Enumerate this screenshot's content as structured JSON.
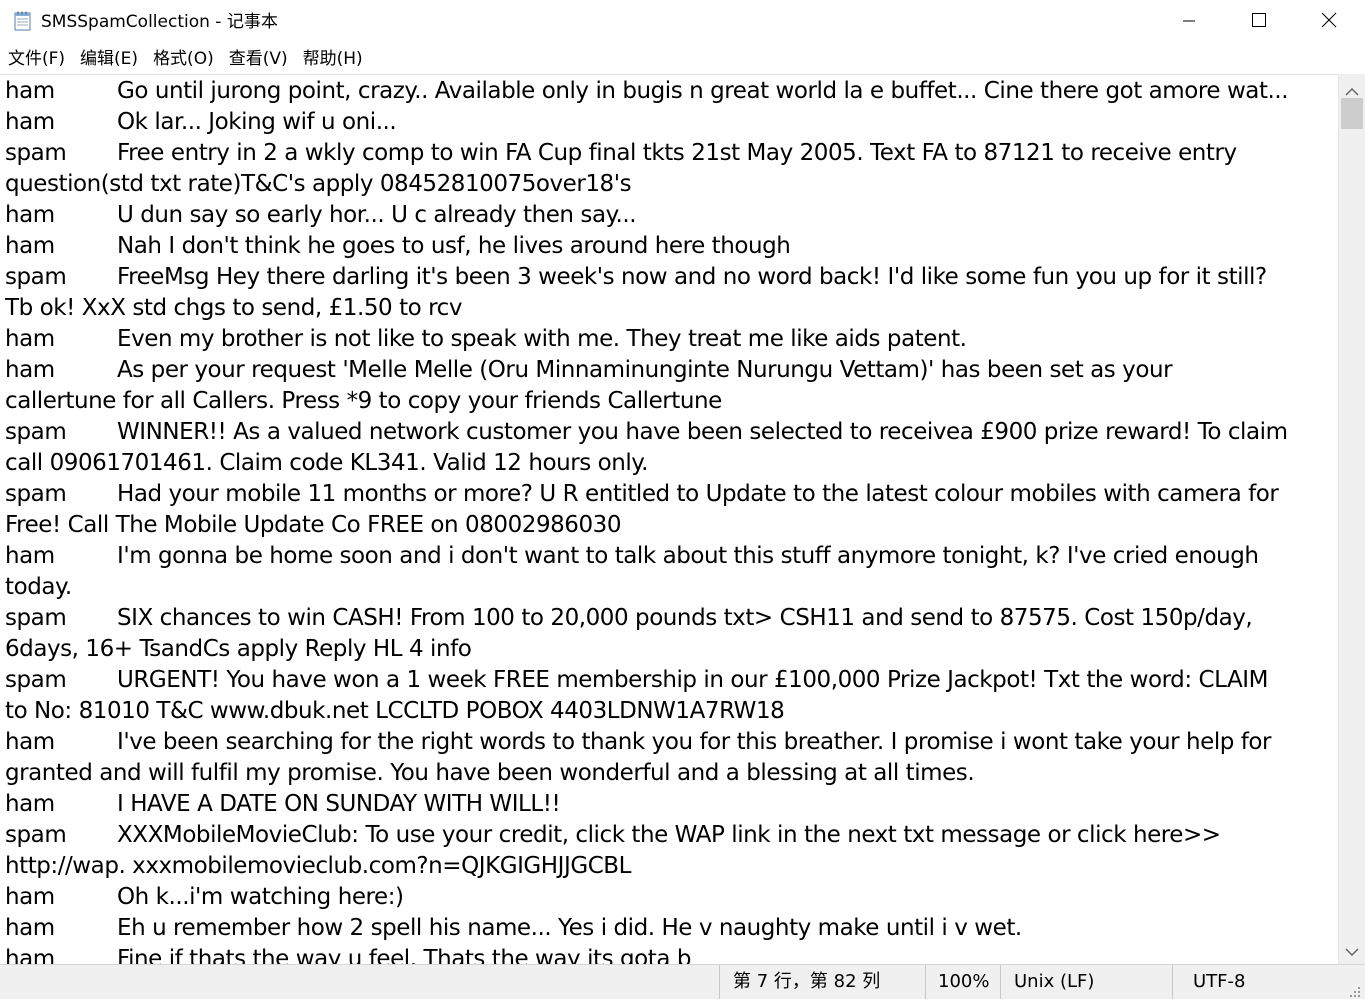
{
  "window": {
    "title": "SMSSpamCollection - 记事本",
    "icon": "notepad-icon",
    "controls": {
      "minimize": "minimize-icon",
      "maximize": "maximize-icon",
      "close": "close-icon"
    }
  },
  "menu": {
    "items": [
      "文件(F)",
      "编辑(E)",
      "格式(O)",
      "查看(V)",
      "帮助(H)"
    ]
  },
  "editor": {
    "lines": [
      {
        "label": "ham",
        "text": "Go until jurong point, crazy.. Available only in bugis n great world la e buffet... Cine there got amore wat..."
      },
      {
        "label": "ham",
        "text": "Ok lar... Joking wif u oni..."
      },
      {
        "label": "spam",
        "text": "Free entry in 2 a wkly comp to win FA Cup final tkts 21st May 2005. Text FA to 87121 to receive entry"
      },
      {
        "label": "",
        "text": "question(std txt rate)T&C's apply 08452810075over18's"
      },
      {
        "label": "ham",
        "text": "U dun say so early hor... U c already then say..."
      },
      {
        "label": "ham",
        "text": "Nah I don't think he goes to usf, he lives around here though"
      },
      {
        "label": "spam",
        "text": "FreeMsg Hey there darling it's been 3 week's now and no word back! I'd like some fun you up for it still?"
      },
      {
        "label": "",
        "text": "Tb ok! XxX std chgs to send, £1.50 to rcv"
      },
      {
        "label": "ham",
        "text": "Even my brother is not like to speak with me. They treat me like aids patent."
      },
      {
        "label": "ham",
        "text": "As per your request 'Melle Melle (Oru Minnaminunginte Nurungu Vettam)' has been set as your"
      },
      {
        "label": "",
        "text": "callertune for all Callers. Press *9 to copy your friends Callertune"
      },
      {
        "label": "spam",
        "text": "WINNER!! As a valued network customer you have been selected to receivea £900 prize reward! To claim"
      },
      {
        "label": "",
        "text": "call 09061701461. Claim code KL341. Valid 12 hours only."
      },
      {
        "label": "spam",
        "text": "Had your mobile 11 months or more? U R entitled to Update to the latest colour mobiles with camera for"
      },
      {
        "label": "",
        "text": "Free! Call The Mobile Update Co FREE on 08002986030"
      },
      {
        "label": "ham",
        "text": "I'm gonna be home soon and i don't want to talk about this stuff anymore tonight, k? I've cried enough"
      },
      {
        "label": "",
        "text": "today."
      },
      {
        "label": "spam",
        "text": "SIX chances to win CASH! From 100 to 20,000 pounds txt> CSH11 and send to 87575. Cost 150p/day,"
      },
      {
        "label": "",
        "text": "6days, 16+ TsandCs apply Reply HL 4 info"
      },
      {
        "label": "spam",
        "text": "URGENT! You have won a 1 week FREE membership in our £100,000 Prize Jackpot! Txt the word: CLAIM"
      },
      {
        "label": "",
        "text": "to No: 81010 T&C www.dbuk.net LCCLTD POBOX 4403LDNW1A7RW18"
      },
      {
        "label": "ham",
        "text": "I've been searching for the right words to thank you for this breather. I promise i wont take your help for"
      },
      {
        "label": "",
        "text": "granted and will fulfil my promise. You have been wonderful and a blessing at all times."
      },
      {
        "label": "ham",
        "text": "I HAVE A DATE ON SUNDAY WITH WILL!!"
      },
      {
        "label": "spam",
        "text": "XXXMobileMovieClub: To use your credit, click the WAP link in the next txt message or click here>>"
      },
      {
        "label": "",
        "text": "http://wap. xxxmobilemovieclub.com?n=QJKGIGHJJGCBL"
      },
      {
        "label": "ham",
        "text": "Oh k...i'm watching here:)"
      },
      {
        "label": "ham",
        "text": "Eh u remember how 2 spell his name... Yes i did. He v naughty make until i v wet."
      },
      {
        "label": "ham",
        "text": "Fine if thats the way u feel. Thats the way its gota b"
      }
    ]
  },
  "scrollbar": {
    "up": "scroll-up-arrow-icon",
    "down": "scroll-down-arrow-icon"
  },
  "status": {
    "position": "第 7 行，第 82 列",
    "zoom": "100%",
    "line_ending": "Unix (LF)",
    "encoding": "UTF-8"
  }
}
